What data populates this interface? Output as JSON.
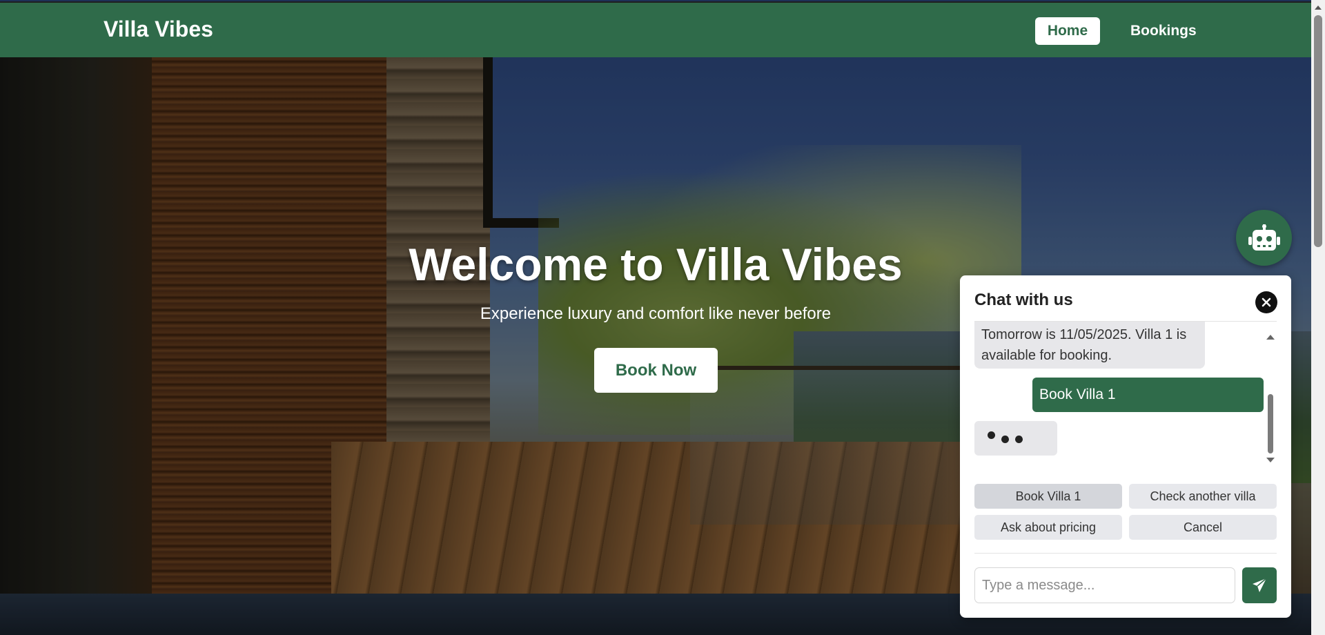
{
  "navbar": {
    "brand": "Villa Vibes",
    "links": [
      {
        "label": "Home",
        "active": true
      },
      {
        "label": "Bookings",
        "active": false
      }
    ]
  },
  "hero": {
    "title": "Welcome to Villa Vibes",
    "subtitle": "Experience luxury and comfort like never before",
    "cta_label": "Book Now"
  },
  "chat": {
    "toggle_icon": "robot-icon",
    "title": "Chat with us",
    "close_icon": "close-icon",
    "messages": [
      {
        "from": "bot",
        "text": "Tomorrow is 11/05/2025. Villa 1 is available for booking."
      },
      {
        "from": "user",
        "text": "Book Villa 1"
      }
    ],
    "typing_indicator": true,
    "quick_replies": [
      "Book Villa 1",
      "Check another villa",
      "Ask about pricing",
      "Cancel"
    ],
    "input_placeholder": "Type a message...",
    "send_icon": "paper-plane-icon"
  },
  "colors": {
    "brand_green": "#2f6b4a",
    "white": "#ffffff",
    "quick_reply_bg": "#e7e8ec",
    "quick_reply_selected_bg": "#d4d6db",
    "bot_bubble_bg": "#e7e7ea"
  }
}
